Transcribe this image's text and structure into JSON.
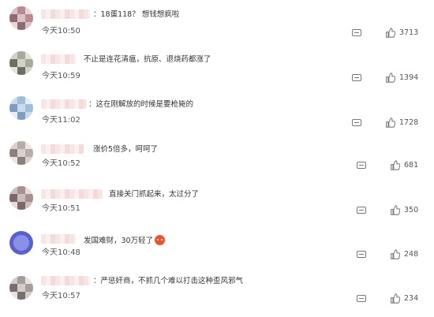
{
  "comments": [
    {
      "text": "：18蛋118？ 想钱想疯啦",
      "time": "今天10:50",
      "likes": "3713",
      "avatar_colors": [
        "#d9c3c6",
        "#b98a90",
        "#e8d6d8",
        "#8f6a70"
      ]
    },
    {
      "text": "不止是连花清瘟，抗原、退烧药都涨了",
      "time": "今天10:59",
      "likes": "1394",
      "avatar_colors": [
        "#d0d3c8",
        "#a7a99a",
        "#e3e1d8",
        "#6d6f62"
      ]
    },
    {
      "text": "：这在刚解放的时候是要枪毙的",
      "time": "今天11:02",
      "likes": "1728",
      "avatar_colors": [
        "#c9dbea",
        "#9fbfd8",
        "#e5eef6",
        "#7d9ec0"
      ]
    },
    {
      "text": "涨价5倍多，呵呵了",
      "time": "今天10:52",
      "likes": "681",
      "avatar_colors": [
        "#d8d2ce",
        "#b7ada6",
        "#ebe6e2",
        "#8c817a"
      ]
    },
    {
      "text": "直接关门抓起来，太过分了",
      "time": "今天10:51",
      "likes": "350",
      "avatar_colors": [
        "#ccbcbc",
        "#a89090",
        "#e6dada",
        "#7c6666"
      ]
    },
    {
      "text": "发国难财，30万轻了",
      "time": "今天10:48",
      "likes": "248",
      "avatar_colors": [
        "#6f74d8",
        "#4c52c2",
        "#9a9ee6",
        "#3a3fa6"
      ]
    },
    {
      "text": "：严惩奸商，不抓几个难以打击这种歪风邪气",
      "time": "今天10:57",
      "likes": "234",
      "avatar_colors": [
        "#d3cccc",
        "#a69c9c",
        "#e8e2e2",
        "#786e6e"
      ]
    }
  ]
}
